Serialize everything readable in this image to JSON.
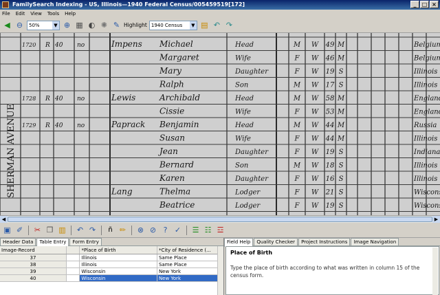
{
  "window": {
    "title": "FamilySearch Indexing - US, Illinois—1940 Federal Census/005459519[172]"
  },
  "menu": [
    "File",
    "Edit",
    "View",
    "Tools",
    "Help"
  ],
  "toolbar": {
    "zoom": "50%",
    "highlight_label": "Highlight",
    "highlight_value": "1940 Census"
  },
  "tabs_left": [
    "Header Data",
    "Table Entry",
    "Form Entry"
  ],
  "tabs_right": [
    "Field Help",
    "Quality Checker",
    "Project Instructions",
    "Image Navigation"
  ],
  "table": {
    "headers": [
      "Image-Record",
      "*Place of Birth",
      "*City of Residence (..."
    ],
    "rows": [
      {
        "record": "37",
        "place": "Illinois",
        "city": "Same Place"
      },
      {
        "record": "38",
        "place": "Illinois",
        "city": "Same Place"
      },
      {
        "record": "39",
        "place": "Wisconsin",
        "city": "New York"
      },
      {
        "record": "40",
        "place": "Wisconsin",
        "city": "New York"
      }
    ]
  },
  "field_help": {
    "title": "Place of Birth",
    "body": "Type the place of birth according to what was written in column 15 of the census form."
  },
  "census_image": {
    "street": "SHERMAN AVENUE",
    "entries": [
      {
        "house": "1720",
        "surname": "Impens",
        "given": "Michael",
        "relation": "Head",
        "sex": "M",
        "race": "W",
        "age": "49",
        "marital": "M",
        "birthplace": "Belgium"
      },
      {
        "house": "",
        "surname": "",
        "given": "Margaret",
        "relation": "Wife",
        "sex": "F",
        "race": "W",
        "age": "46",
        "marital": "M",
        "birthplace": "Belgium"
      },
      {
        "house": "",
        "surname": "",
        "given": "Mary",
        "relation": "Daughter",
        "sex": "F",
        "race": "W",
        "age": "19",
        "marital": "S",
        "birthplace": "Illinois"
      },
      {
        "house": "",
        "surname": "",
        "given": "Ralph",
        "relation": "Son",
        "sex": "M",
        "race": "W",
        "age": "17",
        "marital": "S",
        "birthplace": "Illinois"
      },
      {
        "house": "1728",
        "surname": "Lewis",
        "given": "Archibald",
        "relation": "Head",
        "sex": "M",
        "race": "W",
        "age": "58",
        "marital": "M",
        "birthplace": "England"
      },
      {
        "house": "",
        "surname": "",
        "given": "Cissie",
        "relation": "Wife",
        "sex": "F",
        "race": "W",
        "age": "53",
        "marital": "M",
        "birthplace": "England"
      },
      {
        "house": "1729",
        "surname": "Paprack",
        "given": "Benjamin",
        "relation": "Head",
        "sex": "M",
        "race": "W",
        "age": "44",
        "marital": "M",
        "birthplace": "Russia"
      },
      {
        "house": "",
        "surname": "",
        "given": "Susan",
        "relation": "Wife",
        "sex": "F",
        "race": "W",
        "age": "44",
        "marital": "M",
        "birthplace": "Illinois"
      },
      {
        "house": "",
        "surname": "",
        "given": "Jean",
        "relation": "Daughter",
        "sex": "F",
        "race": "W",
        "age": "19",
        "marital": "S",
        "birthplace": "Indiana"
      },
      {
        "house": "",
        "surname": "",
        "given": "Bernard",
        "relation": "Son",
        "sex": "M",
        "race": "W",
        "age": "18",
        "marital": "S",
        "birthplace": "Illinois"
      },
      {
        "house": "",
        "surname": "",
        "given": "Karen",
        "relation": "Daughter",
        "sex": "F",
        "race": "W",
        "age": "16",
        "marital": "S",
        "birthplace": "Illinois"
      },
      {
        "house": "",
        "surname": "Lang",
        "given": "Thelma",
        "relation": "Lodger",
        "sex": "F",
        "race": "W",
        "age": "21",
        "marital": "S",
        "birthplace": "Wisconsin"
      },
      {
        "house": "",
        "surname": "",
        "given": "Beatrice",
        "relation": "Lodger",
        "sex": "F",
        "race": "W",
        "age": "19",
        "marital": "S",
        "birthplace": "Wisconsin"
      }
    ]
  }
}
